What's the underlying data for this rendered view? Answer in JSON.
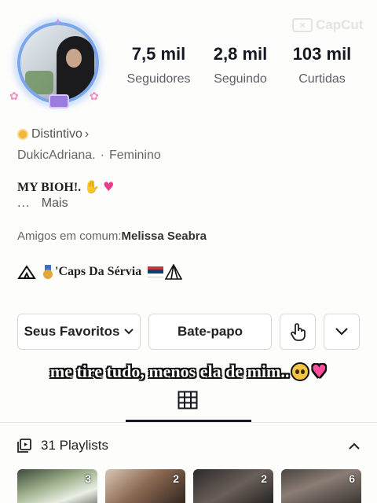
{
  "watermark": {
    "text": "CapCut",
    "icon": "capcut-logo-icon"
  },
  "profile": {
    "stats": [
      {
        "value": "7,5 mil",
        "label": "Seguidores"
      },
      {
        "value": "2,8 mil",
        "label": "Seguindo"
      },
      {
        "value": "103 mil",
        "label": "Curtidas"
      }
    ],
    "badge": {
      "label": "Distintivo",
      "chevron": "›"
    },
    "username": "DukicAdriana.",
    "separator": "·",
    "gender": "Feminino",
    "bio": "MY BIOH!.",
    "bio_more_dots": "...",
    "bio_more_label": "Mais",
    "mutual_prefix": "Amigos em comum:",
    "mutual_name": "Melissa Seabra",
    "caps_text": "'Caps Da Sérvia"
  },
  "actions": {
    "favorites_label": "Seus Favoritos",
    "chat_label": "Bate-papo"
  },
  "overlay_caption": "me tire tudo, menos ela de mim..",
  "playlists": {
    "label": "31 Playlists",
    "thumbs": [
      {
        "count": "3"
      },
      {
        "count": "2"
      },
      {
        "count": "2"
      },
      {
        "count": "6"
      }
    ]
  },
  "colors": {
    "text_primary": "#161823",
    "badge_gold": "#f2b43a",
    "avatar_ring": "#7aa7ec",
    "serbia_red": "#c6363c",
    "serbia_blue": "#0c4076"
  }
}
